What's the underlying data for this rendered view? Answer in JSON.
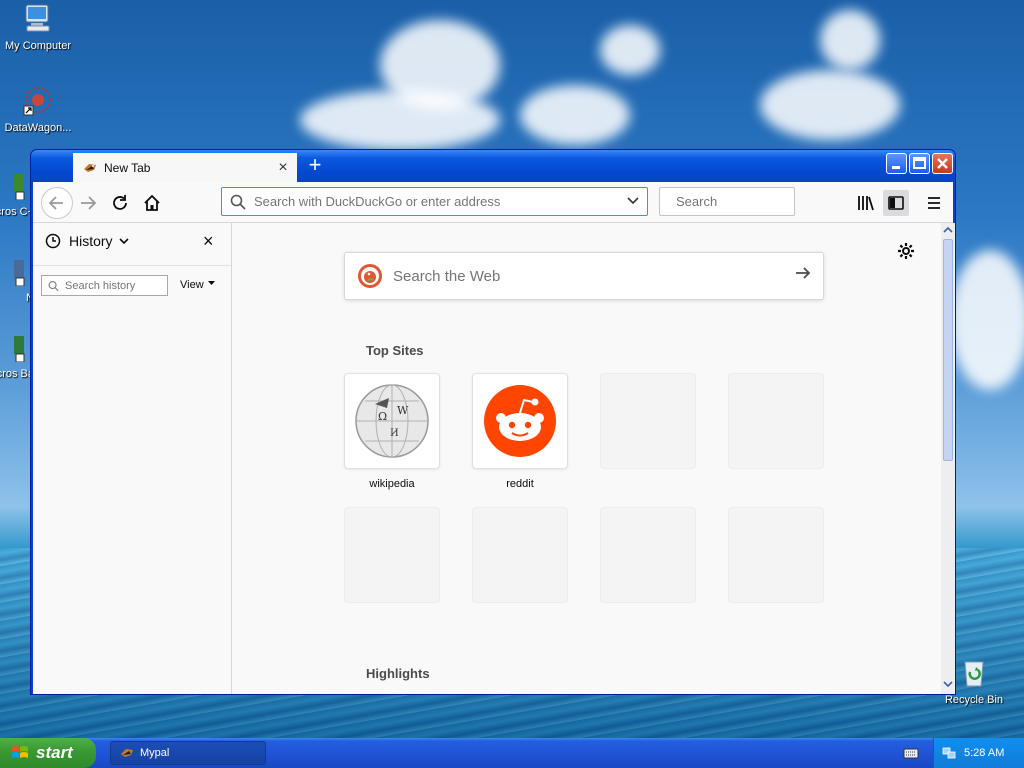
{
  "desktop": {
    "icons": [
      {
        "label": "My Computer"
      },
      {
        "label": "DataWagon..."
      },
      {
        "label": "Micros C+"
      },
      {
        "label": "N"
      },
      {
        "label": "Micros Ba"
      },
      {
        "label": "Recycle Bin"
      }
    ]
  },
  "browser": {
    "tab_title": "New Tab",
    "tab_close": "×",
    "new_tab": "+",
    "url_placeholder": "Search with DuckDuckGo or enter address",
    "search_placeholder": "Search",
    "sidebar": {
      "title": "History",
      "close": "×",
      "search_placeholder": "Search history",
      "view_label": "View"
    },
    "newtab_page": {
      "web_search_placeholder": "Search the Web",
      "top_sites_heading": "Top Sites",
      "highlights_heading": "Highlights",
      "top_sites": [
        {
          "label": "wikipedia",
          "icon": "wikipedia-globe-icon"
        },
        {
          "label": "reddit",
          "icon": "reddit-alien-icon"
        },
        {
          "label": ""
        },
        {
          "label": ""
        },
        {
          "label": ""
        },
        {
          "label": ""
        },
        {
          "label": ""
        },
        {
          "label": ""
        }
      ]
    }
  },
  "taskbar": {
    "start_label": "start",
    "task_label": "Mypal",
    "clock": "5:28 AM"
  },
  "colors": {
    "xp_blue": "#0448d0",
    "start_green": "#3a9a35",
    "reddit_orange": "#ff4500",
    "ddg_orange": "#de5833"
  }
}
